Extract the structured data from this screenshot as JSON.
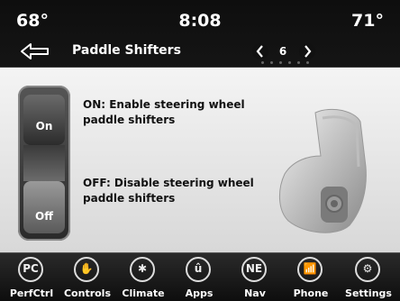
{
  "status": {
    "temp_left": "68°",
    "time": "8:08",
    "temp_right": "71°"
  },
  "header": {
    "title": "Paddle Shifters",
    "page_number": "6"
  },
  "switch": {
    "on_label": "On",
    "off_label": "Off"
  },
  "descriptions": {
    "on_text": "ON: Enable steering wheel paddle shifters",
    "off_text": "OFF: Disable steering wheel paddle shifters"
  },
  "nav": [
    {
      "label": "PerfCtrl",
      "icon": "perf-ctrl-icon",
      "glyph": "PC"
    },
    {
      "label": "Controls",
      "icon": "controls-icon",
      "glyph": "✋"
    },
    {
      "label": "Climate",
      "icon": "climate-icon",
      "glyph": "✱"
    },
    {
      "label": "Apps",
      "icon": "apps-icon",
      "glyph": "û"
    },
    {
      "label": "Nav",
      "icon": "nav-icon",
      "glyph": "NE"
    },
    {
      "label": "Phone",
      "icon": "phone-icon",
      "glyph": "📶"
    },
    {
      "label": "Settings",
      "icon": "settings-icon",
      "glyph": "⚙"
    }
  ],
  "colors": {
    "background": "#000000",
    "content_bg": "#e6e6e6",
    "text_dark": "#111111",
    "nav_bg": "#1a1a1a"
  }
}
